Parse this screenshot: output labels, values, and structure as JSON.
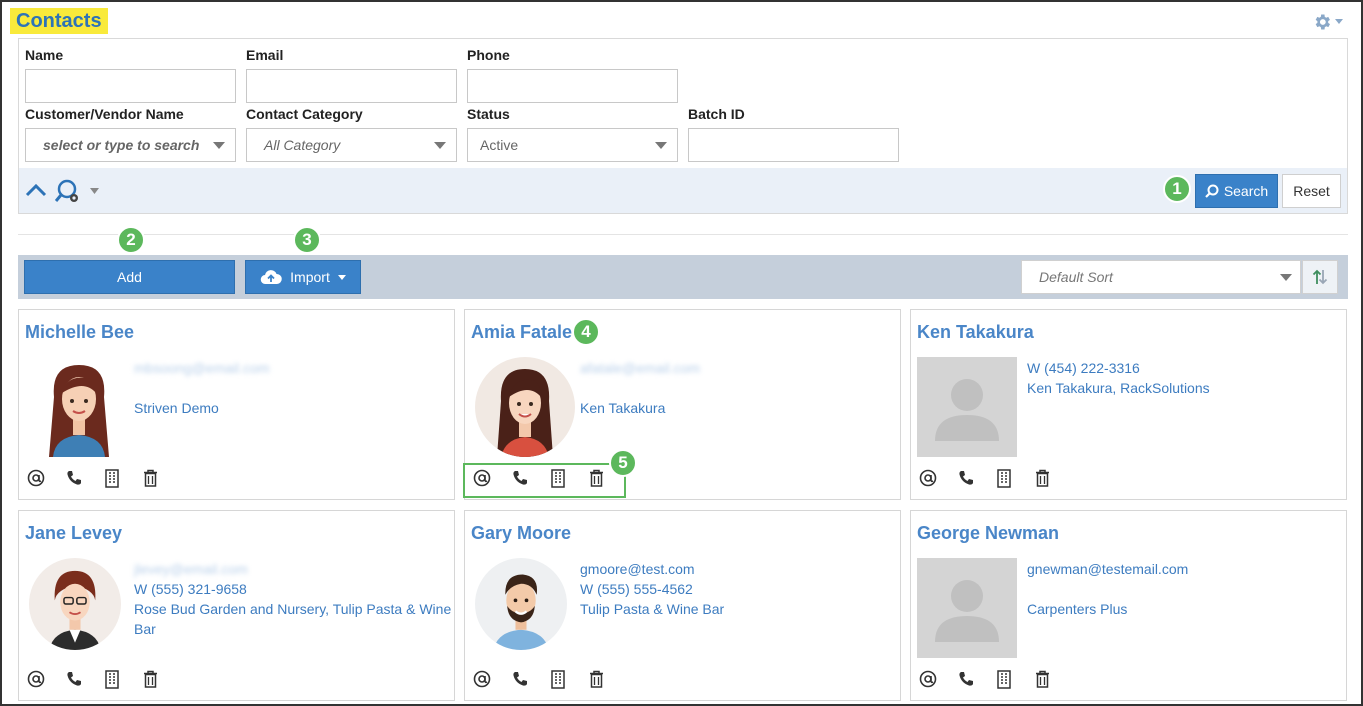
{
  "page": {
    "title": "Contacts"
  },
  "filters": {
    "name_label": "Name",
    "email_label": "Email",
    "phone_label": "Phone",
    "customer_vendor_label": "Customer/Vendor Name",
    "customer_vendor_placeholder": "select or type to search",
    "contact_category_label": "Contact Category",
    "contact_category_value": "All Category",
    "status_label": "Status",
    "status_value": "Active",
    "batch_id_label": "Batch ID",
    "search_label": "Search",
    "reset_label": "Reset"
  },
  "toolbar": {
    "add_label": "Add",
    "import_label": "Import",
    "sort_value": "Default Sort"
  },
  "badges": [
    "1",
    "2",
    "3",
    "4",
    "5"
  ],
  "contacts": [
    {
      "name": "Michelle Bee",
      "email": "mbsoong@email.com",
      "email_blurred": true,
      "phone": "",
      "company": "Striven Demo"
    },
    {
      "name": "Amia Fatale",
      "email": "afatale@email.com",
      "email_blurred": true,
      "phone": "",
      "company": "Ken Takakura"
    },
    {
      "name": "Ken Takakura",
      "email": "W (454) 222-3316",
      "email_blurred": false,
      "phone": "Ken Takakura, RackSolutions",
      "company": ""
    },
    {
      "name": "Jane Levey",
      "email": "jlevey@email.com",
      "email_blurred": true,
      "phone": "W (555) 321-9658",
      "company": "Rose Bud Garden and Nursery, Tulip Pasta & Wine Bar"
    },
    {
      "name": "Gary Moore",
      "email": "gmoore@test.com",
      "email_blurred": false,
      "phone": "W (555) 555-4562",
      "company": "Tulip Pasta & Wine Bar"
    },
    {
      "name": "George Newman",
      "email": "gnewman@testemail.com",
      "email_blurred": false,
      "phone": "",
      "company": "Carpenters Plus"
    }
  ],
  "colors": {
    "accent": "#3a82c9",
    "link": "#4a86c8",
    "highlight": "#f9ea3b",
    "badge": "#5cb85c",
    "toolbar": "#c5cfdb"
  }
}
